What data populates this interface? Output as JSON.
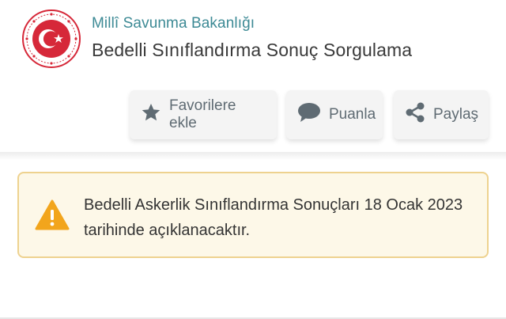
{
  "header": {
    "organization": "Millî Savunma Bakanlığı",
    "service_title": "Bedelli Sınıflandırma Sonuç Sorgulama",
    "seal_icon": "msb-seal-icon"
  },
  "actions": [
    {
      "label": "Favorilere ekle",
      "icon": "star-icon"
    },
    {
      "label": "Puanla",
      "icon": "speech-bubble-icon"
    },
    {
      "label": "Paylaş",
      "icon": "share-icon"
    }
  ],
  "alert": {
    "icon": "warning-icon",
    "message": "Bedelli Askerlik Sınıflandırma Sonuçları 18 Ocak 2023 tarihinde açıklanacaktır."
  },
  "colors": {
    "org_name": "#3d8a95",
    "seal_red": "#d62839",
    "alert_bg": "#fdf8e8",
    "alert_border": "#eed28f",
    "warning": "#f2a51c"
  }
}
